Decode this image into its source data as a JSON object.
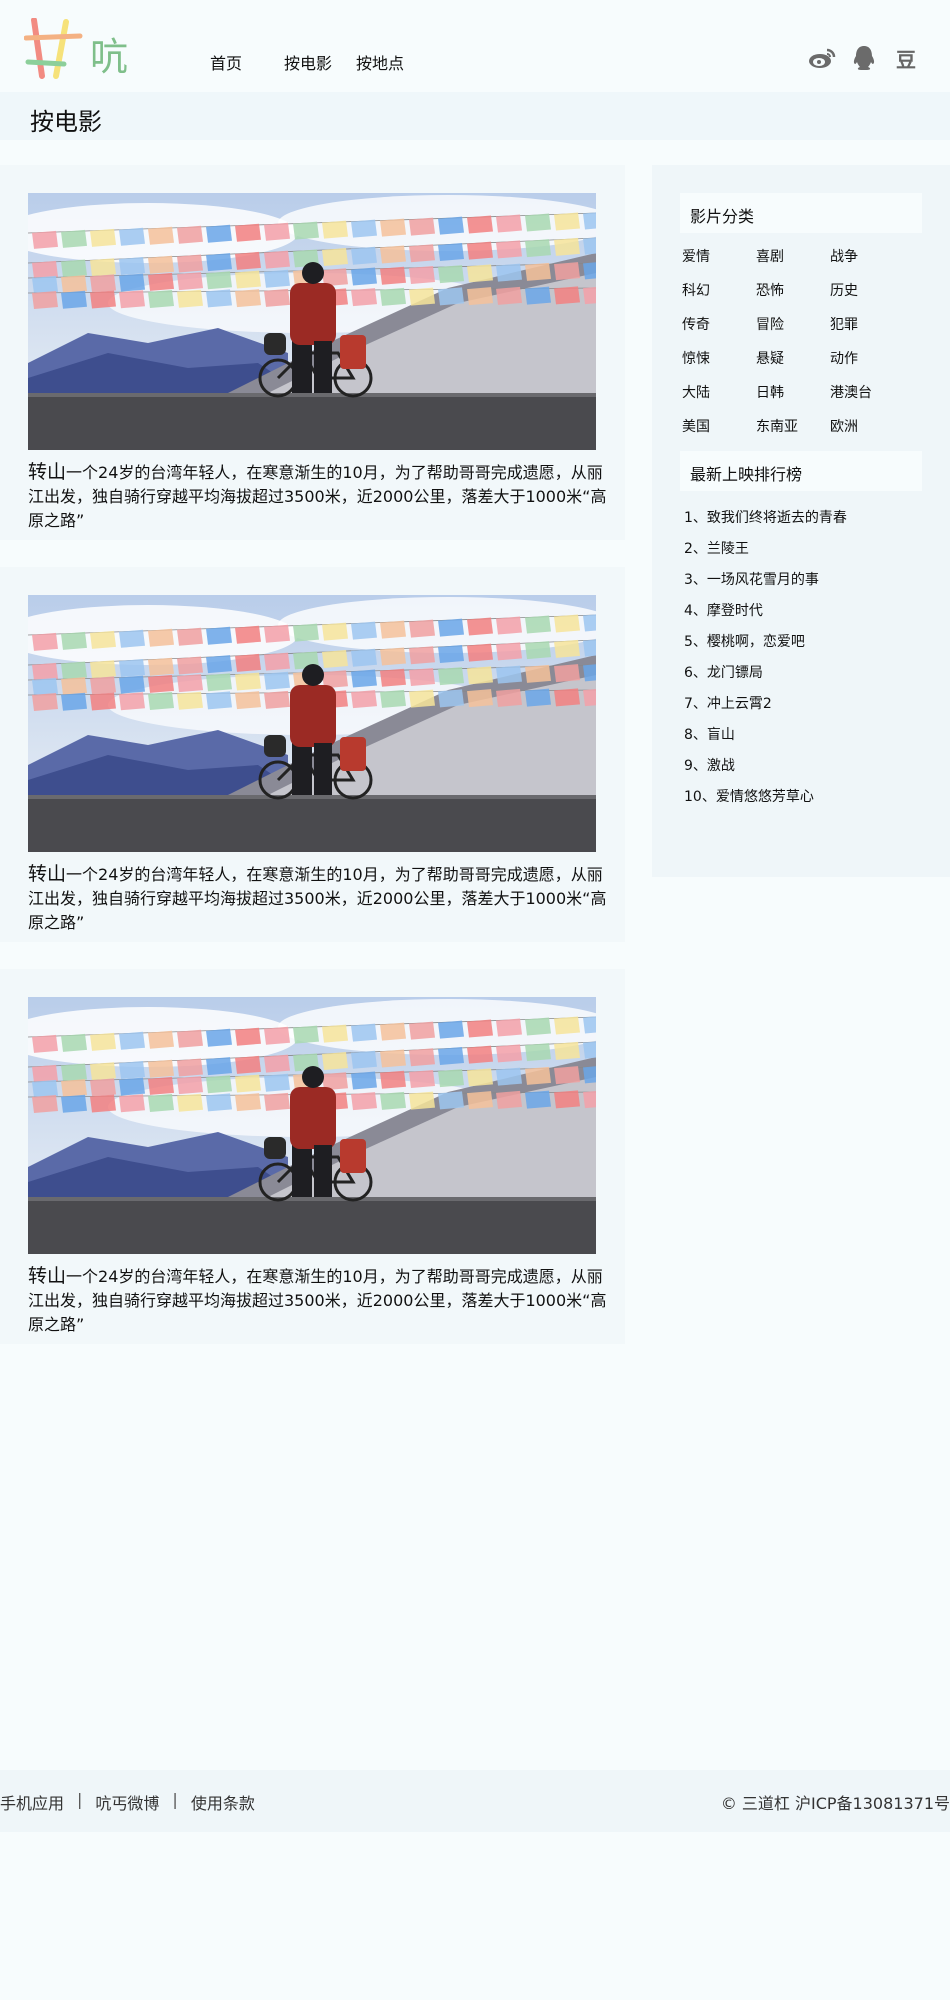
{
  "header": {
    "logo_text": "吭丐",
    "nav": [
      "首页",
      "按电影",
      "按地点"
    ],
    "social": [
      {
        "icon": "weibo-icon"
      },
      {
        "icon": "qq-icon"
      },
      {
        "icon": "douban-icon",
        "label": "豆"
      }
    ]
  },
  "page_title": "按电影",
  "posts": [
    {
      "lead": "转山",
      "text": "一个24岁的台湾年轻人，在寒意渐生的10月，为了帮助哥哥完成遗愿，从丽江出发，独自骑行穿越平均海拔超过3500米，近2000公里，落差大于1000米“高原之路”"
    },
    {
      "lead": "转山",
      "text": "一个24岁的台湾年轻人，在寒意渐生的10月，为了帮助哥哥完成遗愿，从丽江出发，独自骑行穿越平均海拔超过3500米，近2000公里，落差大于1000米“高原之路”"
    },
    {
      "lead": "转山",
      "text": "一个24岁的台湾年轻人，在寒意渐生的10月，为了帮助哥哥完成遗愿，从丽江出发，独自骑行穿越平均海拔超过3500米，近2000公里，落差大于1000米“高原之路”"
    }
  ],
  "sidebar": {
    "categories_title": "影片分类",
    "categories": [
      "爱情",
      "喜剧",
      "战争",
      "科幻",
      "恐怖",
      "历史",
      "传奇",
      "冒险",
      "犯罪",
      "惊悚",
      "悬疑",
      "动作",
      "大陆",
      "日韩",
      "港澳台",
      "美国",
      "东南亚",
      "欧洲"
    ],
    "ranking_title": "最新上映排行榜",
    "ranking": [
      "1、致我们终将逝去的青春",
      "2、兰陵王",
      "3、一场风花雪月的事",
      "4、摩登时代",
      "5、樱桃啊，恋爱吧",
      "6、龙门镖局",
      "7、冲上云霄2",
      "8、盲山",
      "9、激战",
      "10、爱情悠悠芳草心"
    ]
  },
  "footer": {
    "links": [
      "手机应用",
      "吭丐微博",
      "使用条款"
    ],
    "separator": "|",
    "copyright": "© 三道杠 沪ICP备13081371号"
  },
  "colors": {
    "page_bg": "#f7fcfd",
    "panel_bg": "#f2f8fa",
    "logo_green": "#7fbf8a"
  }
}
